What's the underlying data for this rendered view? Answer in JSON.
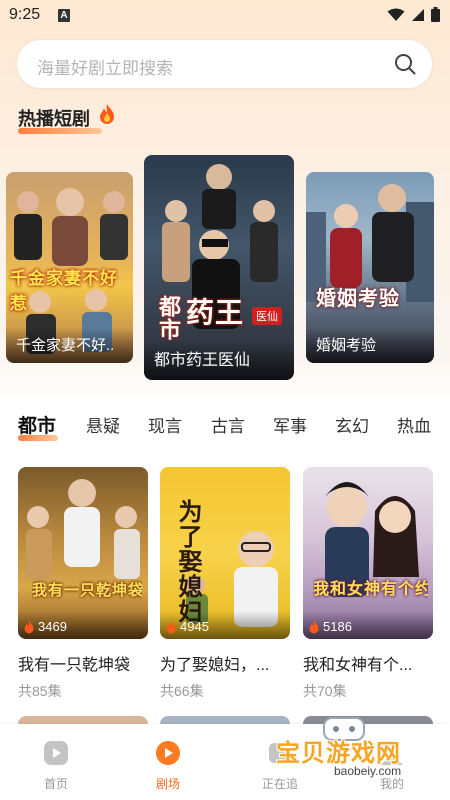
{
  "status_bar": {
    "time": "9:25",
    "sim_label": "A"
  },
  "search": {
    "placeholder": "海量好剧立即搜索"
  },
  "hot_section": {
    "title": "热播短剧",
    "items": [
      {
        "label": "千金家妻不好..",
        "poster_text": "千金家妻不好惹"
      },
      {
        "label": "都市药王医仙",
        "poster_text_1": "都市",
        "poster_text_2": "药王",
        "poster_badge": "医仙"
      },
      {
        "label": "婚姻考验",
        "poster_text": "婚姻考验"
      }
    ]
  },
  "categories": [
    "都市",
    "悬疑",
    "现言",
    "古言",
    "军事",
    "玄幻",
    "热血"
  ],
  "active_category": "都市",
  "dramas": [
    {
      "title": "我有一只乾坤袋",
      "views": "3469",
      "episodes": "共85集",
      "poster_text": "我有一只乾坤袋"
    },
    {
      "title": "为了娶媳妇，...",
      "views": "4945",
      "episodes": "共66集",
      "poster_text": "为了娶媳妇"
    },
    {
      "title": "我和女神有个...",
      "views": "5186",
      "episodes": "共70集",
      "poster_text": "我和女神有个约定"
    }
  ],
  "bottom_nav": [
    {
      "label": "首页",
      "icon": "play-icon",
      "active": false
    },
    {
      "label": "剧场",
      "icon": "theater-icon",
      "active": true
    },
    {
      "label": "正在追",
      "icon": "following-icon",
      "active": false
    },
    {
      "label": "我的",
      "icon": "profile-icon",
      "active": false
    }
  ],
  "watermark": {
    "text": "宝贝游戏网",
    "url": "baobeiy.com"
  },
  "colors": {
    "accent": "#ff6a1e",
    "text": "#222222",
    "muted": "#999999"
  }
}
